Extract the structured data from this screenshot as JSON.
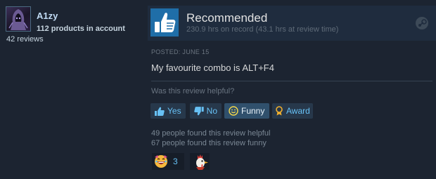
{
  "reviewer": {
    "username": "A1zy",
    "products": "112 products in account",
    "reviews": "42 reviews"
  },
  "header": {
    "verdict": "Recommended",
    "hours": "230.9 hrs on record (43.1 hrs at review time)"
  },
  "review": {
    "posted": "POSTED: JUNE 15",
    "text": "My favourite combo is ALT+F4"
  },
  "helpful": {
    "question": "Was this review helpful?",
    "yes_label": "Yes",
    "no_label": "No",
    "funny_label": "Funny",
    "award_label": "Award"
  },
  "stats": {
    "helpful_count": "49 people found this review helpful",
    "funny_count": "67 people found this review funny"
  },
  "awards": [
    {
      "icon": "laughing-face-award-icon",
      "count": "3"
    },
    {
      "icon": "rooster-award-icon"
    }
  ],
  "colors": {
    "accent": "#67c1f5",
    "background": "#1c2431",
    "thumb_box": "#1f6ea8",
    "funny_active": "#30506c"
  }
}
